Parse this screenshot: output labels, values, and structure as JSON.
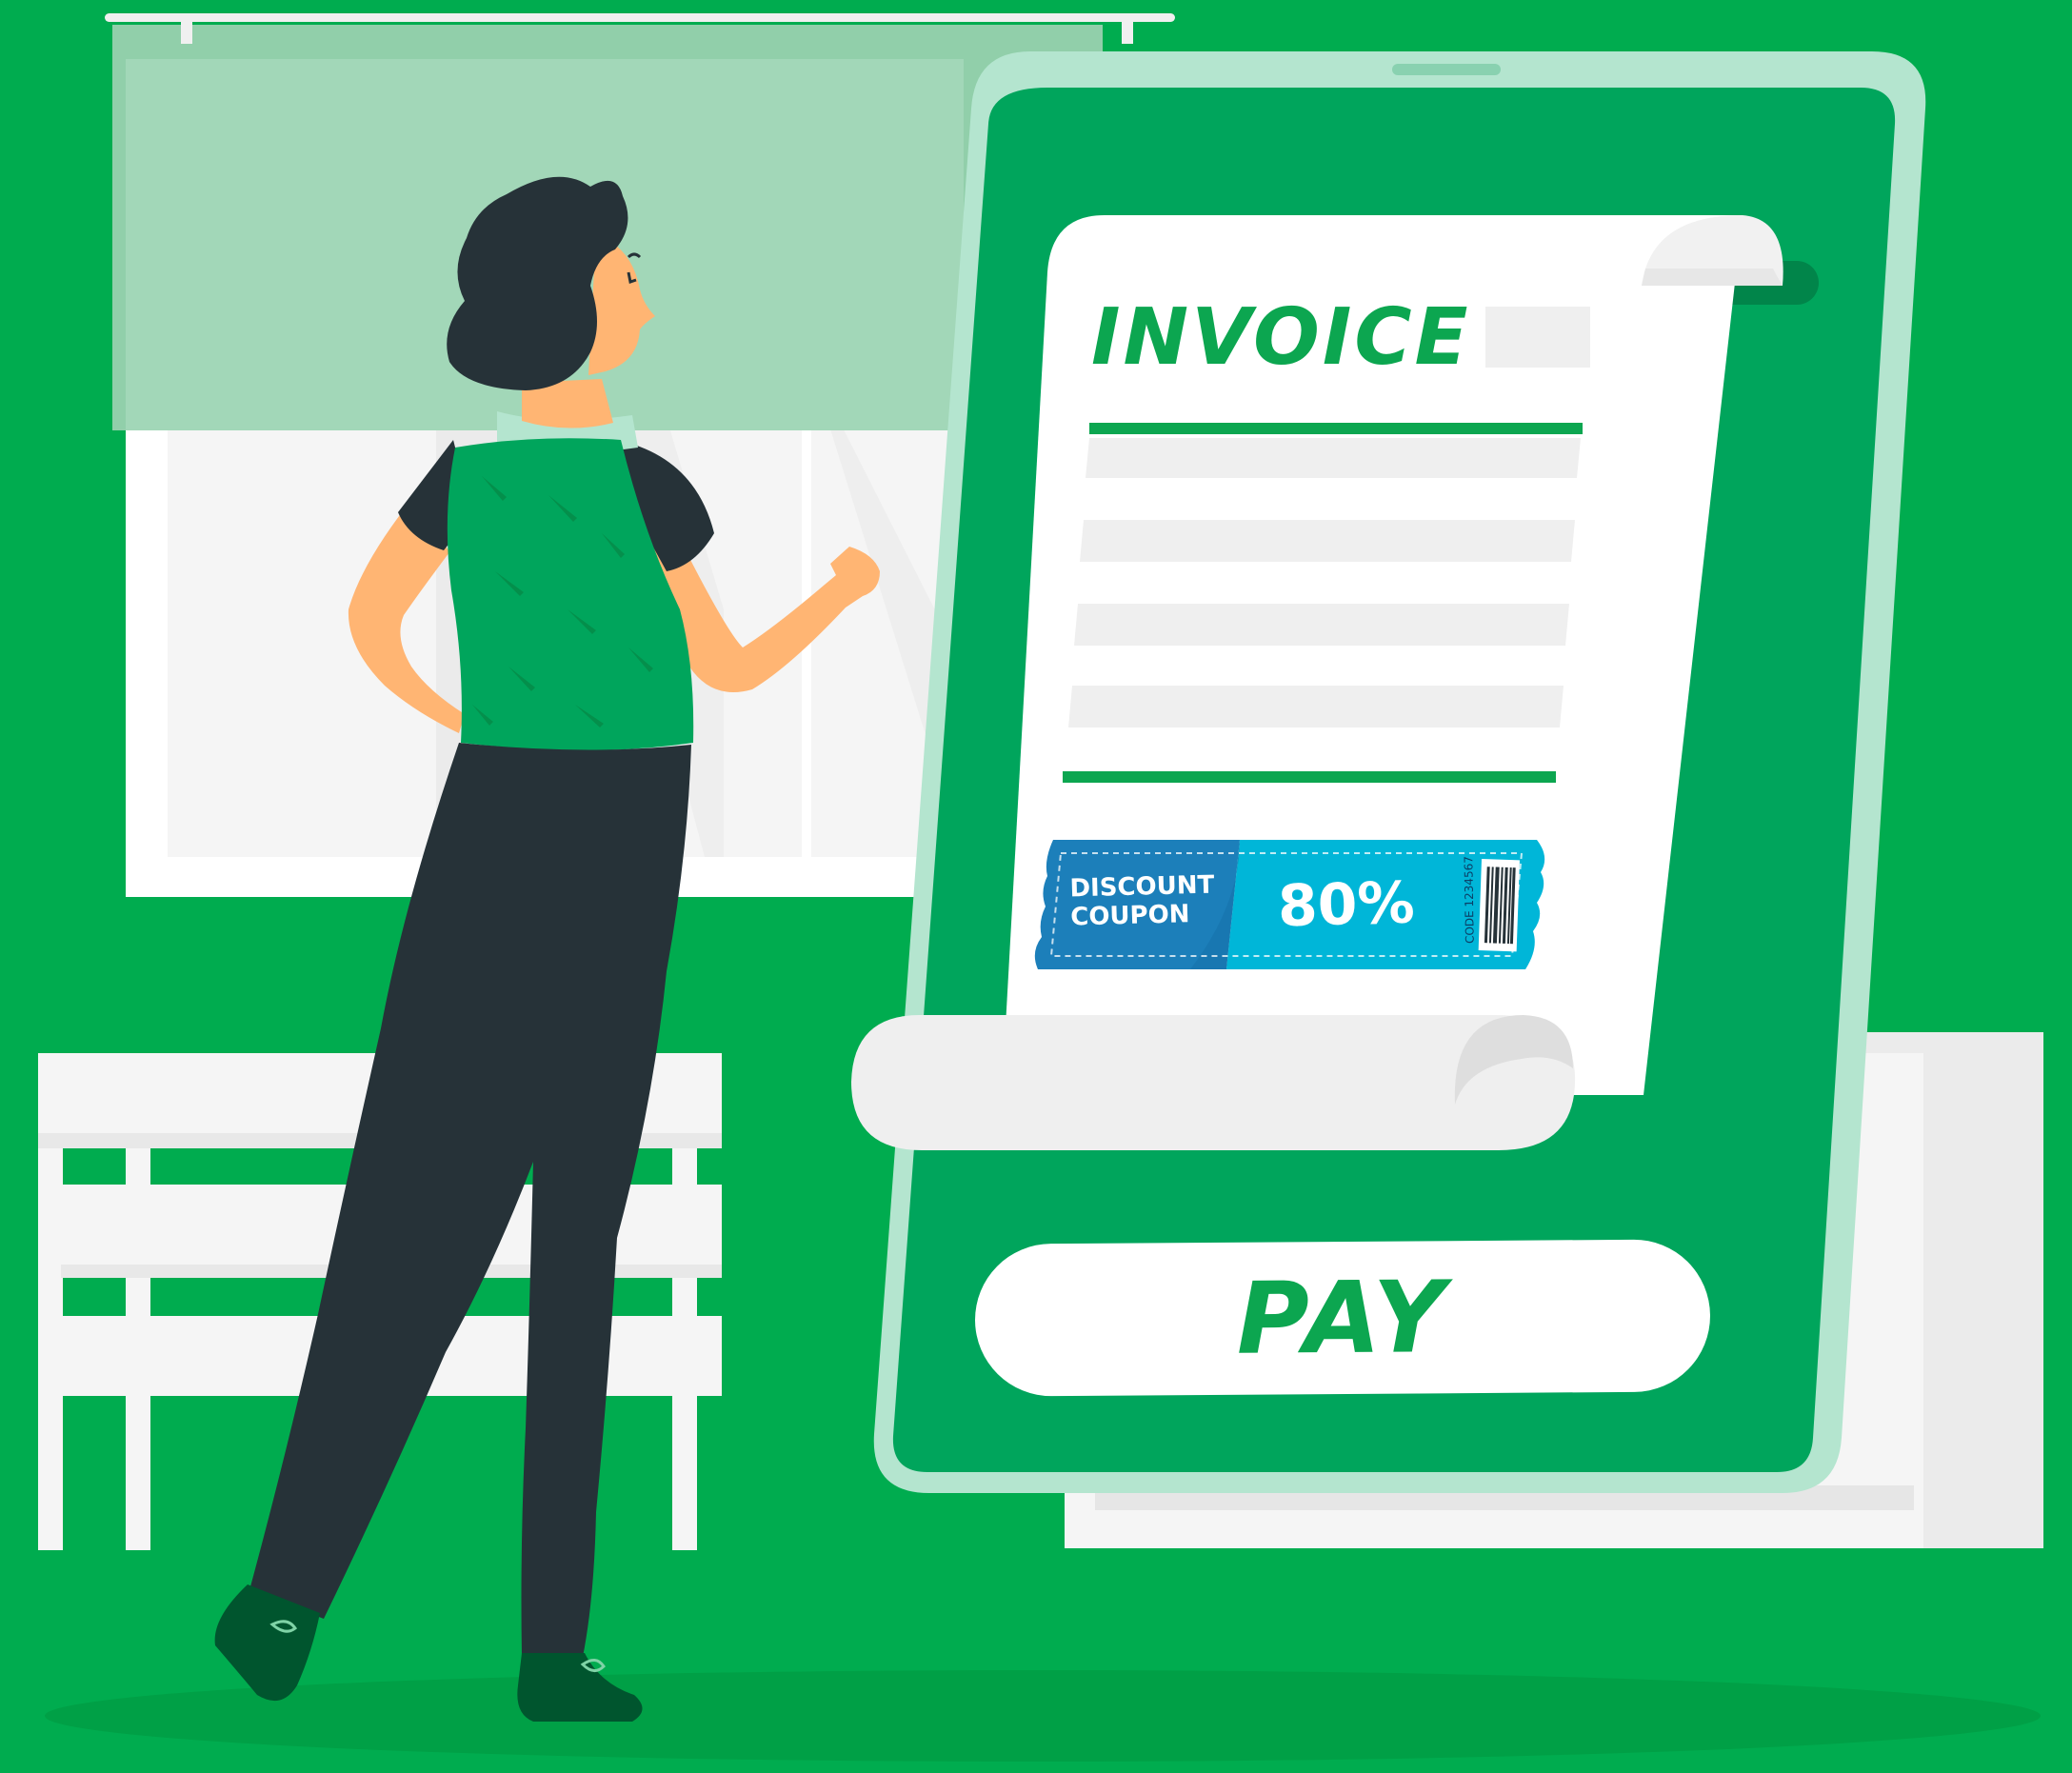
{
  "invoice": {
    "title": "INVOICE"
  },
  "coupon": {
    "label_line1": "DISCOUNT",
    "label_line2": "COUPON",
    "percent": "80%",
    "code": "CODE 1234567"
  },
  "pay_button": {
    "label": "PAY"
  },
  "colors": {
    "background": "#00ac4f",
    "tablet_screen": "#00a55c",
    "tablet_frame": "#b4e5cf",
    "paper": "#ffffff",
    "paper_line": "#efefef",
    "accent_green": "#0ca650",
    "coupon_dark": "#1c7fba",
    "coupon_light": "#00b6d8",
    "outfit_dark": "#263238",
    "skin": "#ffb573"
  },
  "icons": {
    "barcode": "barcode-icon"
  }
}
